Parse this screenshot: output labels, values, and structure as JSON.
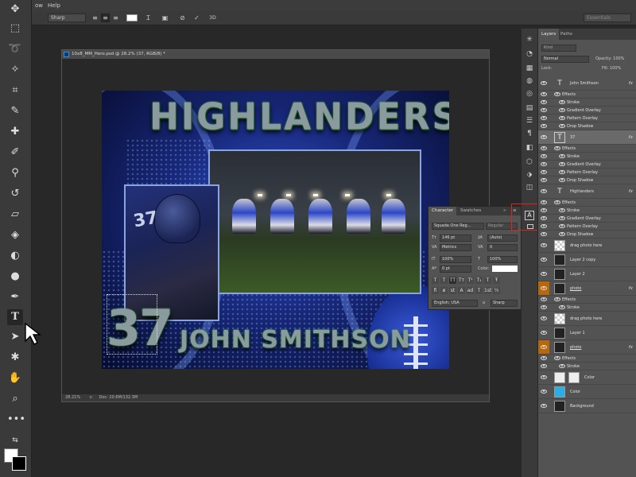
{
  "menubar": {
    "items": [
      "ow",
      "Help"
    ]
  },
  "options": {
    "aa_method": "Sharp",
    "workspace": "Essentials"
  },
  "document": {
    "title": "10x8_MM_Hero.psd @ 28.2% (37, RGB/8) *",
    "zoom": "28.21%",
    "doc_size": "Doc: 20.6M/132.3M"
  },
  "artwork": {
    "headline": "HIGHLANDERS",
    "number": "37",
    "jersey_number": "37",
    "player_name": "JOHN SMITHSON"
  },
  "character_panel": {
    "tabs": [
      "Character",
      "Swatches"
    ],
    "font_family": "Squada One Reg...",
    "font_style": "Regular",
    "font_size": "146 pt",
    "leading": "(Auto)",
    "kerning": "Metrics",
    "tracking": "0",
    "vscale": "100%",
    "hscale": "100%",
    "baseline": "0 pt",
    "color_label": "Color:",
    "language": "English: USA",
    "aa": "Sharp",
    "aa_label": "a"
  },
  "layers_panel": {
    "tabs": [
      "Layers",
      "Paths"
    ],
    "search": "Kind",
    "blend_mode": "Normal",
    "opacity": "Opacity: 100%",
    "fill": "Fill: 100%",
    "lock": "Lock:",
    "rows": [
      {
        "name": "John Smithson",
        "type": "text",
        "fx": "fx"
      },
      {
        "name": "Effects",
        "type": "effects"
      },
      {
        "name": "Stroke",
        "type": "effect"
      },
      {
        "name": "Gradient Overlay",
        "type": "effect"
      },
      {
        "name": "Pattern Overlay",
        "type": "effect"
      },
      {
        "name": "Drop Shadow",
        "type": "effect"
      },
      {
        "name": "37",
        "type": "text-selected",
        "fx": "fx"
      },
      {
        "name": "Effects",
        "type": "effects"
      },
      {
        "name": "Stroke",
        "type": "effect"
      },
      {
        "name": "Gradient Overlay",
        "type": "effect"
      },
      {
        "name": "Pattern Overlay",
        "type": "effect"
      },
      {
        "name": "Drop Shadow",
        "type": "effect"
      },
      {
        "name": "Highlanders",
        "type": "text",
        "fx": "fx"
      },
      {
        "name": "Effects",
        "type": "effects"
      },
      {
        "name": "Stroke",
        "type": "effect"
      },
      {
        "name": "Gradient Overlay",
        "type": "effect"
      },
      {
        "name": "Pattern Overlay",
        "type": "effect"
      },
      {
        "name": "Drop Shadow",
        "type": "effect"
      },
      {
        "name": "drag photo here",
        "type": "image-checker"
      },
      {
        "name": "Layer 2 copy",
        "type": "image"
      },
      {
        "name": "Layer 2",
        "type": "image"
      },
      {
        "name": "photo",
        "type": "shape-orange",
        "fx": "fx"
      },
      {
        "name": "Effects",
        "type": "effects"
      },
      {
        "name": "Stroke",
        "type": "effect"
      },
      {
        "name": "drag photo here",
        "type": "image-checker"
      },
      {
        "name": "Layer 1",
        "type": "image"
      },
      {
        "name": "photo",
        "type": "shape-orange",
        "fx": "fx"
      },
      {
        "name": "Effects",
        "type": "effects"
      },
      {
        "name": "Stroke",
        "type": "effect"
      },
      {
        "name": "Color",
        "type": "adjust"
      },
      {
        "name": "Color",
        "type": "blue"
      },
      {
        "name": "Background",
        "type": "background"
      }
    ]
  }
}
